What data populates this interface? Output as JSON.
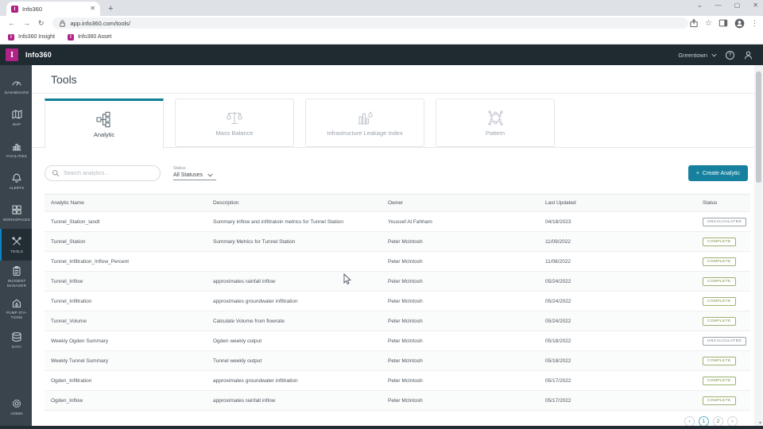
{
  "browser": {
    "tab": {
      "title": "Info360",
      "favicon_letter": "I"
    },
    "url": "app.info360.com/tools/",
    "bookmarks": [
      {
        "label": "Info360 Insight",
        "favicon_letter": "I"
      },
      {
        "label": "Info360 Asset",
        "favicon_letter": "I"
      }
    ]
  },
  "app_header": {
    "logo_letter": "I",
    "brand": "Info360",
    "tenant": "Greentown",
    "help_glyph": "?"
  },
  "sidebar": {
    "items": [
      {
        "label": "DASHBOARD",
        "icon": "gauge-icon"
      },
      {
        "label": "MAP",
        "icon": "map-icon"
      },
      {
        "label": "FACILITIES",
        "icon": "facilities-icon"
      },
      {
        "label": "ALERTS",
        "icon": "bell-icon"
      },
      {
        "label": "WORKSPACES",
        "icon": "workspaces-icon"
      },
      {
        "label": "TOOLS",
        "icon": "tools-icon",
        "active": true
      },
      {
        "label": "INCIDENT MANAGER",
        "icon": "incident-icon"
      },
      {
        "label": "PUMP STA-TIONS",
        "icon": "pump-station-icon"
      },
      {
        "label": "DATA",
        "icon": "database-icon"
      },
      {
        "label": "ADMIN",
        "icon": "gear-icon"
      }
    ]
  },
  "page": {
    "title": "Tools",
    "tool_tabs": [
      {
        "label": "Analytic",
        "icon": "analytic-icon",
        "active": true
      },
      {
        "label": "Mass Balance",
        "icon": "scales-icon",
        "active": false
      },
      {
        "label": "Infrastructure Leakage Index",
        "icon": "leakage-bars-icon",
        "active": false
      },
      {
        "label": "Pattern",
        "icon": "pattern-network-icon",
        "active": false
      }
    ],
    "search_placeholder": "Search analytics...",
    "status_filter": {
      "label": "Status",
      "value": "All Statuses"
    },
    "create_button_label": "Create Analytic",
    "create_button_plus": "+"
  },
  "table": {
    "columns": [
      "Analytic Name",
      "Description",
      "Owner",
      "Last Updated",
      "Status"
    ],
    "rows": [
      {
        "name": "Tunnel_Station_IandI",
        "description": "Summary inflow and infiltratoin metrics for Tunnel Station",
        "owner": "Youssef Al Fahham",
        "updated": "04/18/2023",
        "status": "UNCALCULATED"
      },
      {
        "name": "Tunnel_Station",
        "description": "Summary Metrics for Tunnel Station",
        "owner": "Peter McIntosh",
        "updated": "11/09/2022",
        "status": "COMPLETE"
      },
      {
        "name": "Tunnel_Infiltration_Inflow_Percent",
        "description": "",
        "owner": "Peter McIntosh",
        "updated": "11/08/2022",
        "status": "COMPLETE"
      },
      {
        "name": "Tunnel_Inflow",
        "description": "approximates rainfall inflow",
        "owner": "Peter McIntosh",
        "updated": "05/24/2022",
        "status": "COMPLETE"
      },
      {
        "name": "Tunnel_Infiltration",
        "description": "approximates groundwater infiltration",
        "owner": "Peter McIntosh",
        "updated": "05/24/2022",
        "status": "COMPLETE"
      },
      {
        "name": "Tunnel_Volume",
        "description": "Calculate Volume from flowrate",
        "owner": "Peter McIntosh",
        "updated": "05/24/2022",
        "status": "COMPLETE"
      },
      {
        "name": "Weekly Ogden Summary",
        "description": "Ogden weekly output",
        "owner": "Peter McIntosh",
        "updated": "05/18/2022",
        "status": "UNCALCULATED"
      },
      {
        "name": "Weekly Tunnel Summary",
        "description": "Tunnel weekly output",
        "owner": "Peter McIntosh",
        "updated": "05/18/2022",
        "status": "COMPLETE"
      },
      {
        "name": "Ogden_Infiltration",
        "description": "approximates groundwater infiltration",
        "owner": "Peter McIntosh",
        "updated": "05/17/2022",
        "status": "COMPLETE"
      },
      {
        "name": "Ogden_Inflow",
        "description": "approximates rainfall inflow",
        "owner": "Peter McIntosh",
        "updated": "05/17/2022",
        "status": "COMPLETE"
      }
    ]
  },
  "pagination": {
    "prev": "‹",
    "page1": "1",
    "page2": "2",
    "next": "›",
    "active_page": "1"
  },
  "colors": {
    "accent_teal": "#16819e",
    "brand_magenta": "#b02285",
    "header_dark": "#1f2a31",
    "sidebar_dark": "#3a444c",
    "status_complete": "#6f8f44",
    "status_uncalculated": "#6f7a81"
  }
}
